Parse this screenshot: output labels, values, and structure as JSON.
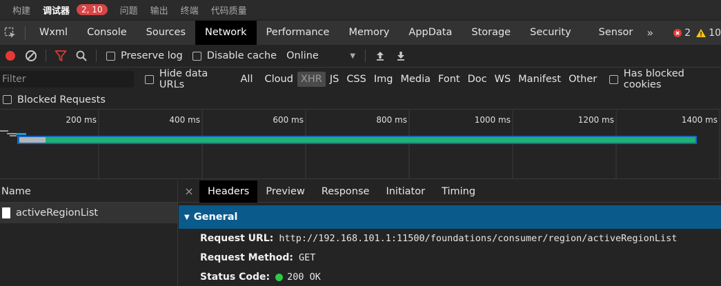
{
  "topbar": {
    "tabs": [
      "构建",
      "调试器",
      "问题",
      "输出",
      "终端",
      "代码质量"
    ],
    "badge": "2, 10"
  },
  "devtools_tabs": [
    "Wxml",
    "Console",
    "Sources",
    "Network",
    "Performance",
    "Memory",
    "AppData",
    "Storage",
    "Security",
    "Sensor"
  ],
  "more_label": "»",
  "counts": {
    "errors": "2",
    "warnings": "10"
  },
  "colors": {
    "error": "#e53935",
    "warning": "#f5c518",
    "record": "#e53935",
    "filter_active": "#e53935",
    "accent_general": "#0b5a8c",
    "status_ok": "#2ec946"
  },
  "toolbar": {
    "preserve_log": "Preserve log",
    "disable_cache": "Disable cache",
    "throttle": "Online",
    "icons": [
      "record-icon",
      "clear-icon",
      "filter-icon",
      "search-icon",
      "upload-icon",
      "download-icon"
    ]
  },
  "filter": {
    "placeholder": "Filter",
    "hide_data_urls": "Hide data URLs",
    "types": [
      "All",
      "Cloud",
      "XHR",
      "JS",
      "CSS",
      "Img",
      "Media",
      "Font",
      "Doc",
      "WS",
      "Manifest",
      "Other"
    ],
    "active_type": "XHR",
    "has_blocked_cookies": "Has blocked cookies",
    "blocked_requests": "Blocked Requests"
  },
  "timeline": {
    "ticks": [
      "200 ms",
      "400 ms",
      "600 ms",
      "800 ms",
      "1000 ms",
      "1200 ms",
      "1400 ms"
    ]
  },
  "requests": {
    "header": "Name",
    "items": [
      "activeRegionList"
    ]
  },
  "details": {
    "close": "×",
    "tabs": [
      "Headers",
      "Preview",
      "Response",
      "Initiator",
      "Timing"
    ],
    "active_tab": "Headers",
    "section": "General",
    "fields": [
      {
        "key": "Request URL:",
        "value": "http://192.168.101.1:11500/foundations/consumer/region/activeRegionList"
      },
      {
        "key": "Request Method:",
        "value": "GET"
      },
      {
        "key": "Status Code:",
        "value": "200 OK"
      }
    ]
  }
}
